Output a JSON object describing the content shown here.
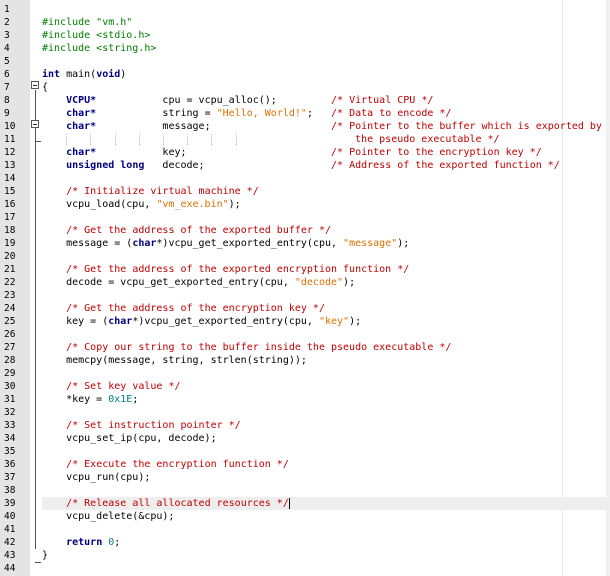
{
  "editor": {
    "colors": {
      "keyword": "#000080",
      "string": "#e07000",
      "comment": "#c00000",
      "preprocessor": "#008000",
      "number": "#008080"
    },
    "current_line": 39,
    "lines": [
      {
        "n": "1",
        "t": []
      },
      {
        "n": "2",
        "t": [
          {
            "c": "pp",
            "s": "#include \"vm.h\""
          }
        ]
      },
      {
        "n": "3",
        "t": [
          {
            "c": "pp",
            "s": "#include <stdio.h>"
          }
        ]
      },
      {
        "n": "4",
        "t": [
          {
            "c": "pp",
            "s": "#include <string.h>"
          }
        ]
      },
      {
        "n": "5",
        "t": []
      },
      {
        "n": "6",
        "t": [
          {
            "c": "kw",
            "s": "int"
          },
          {
            "c": "",
            "s": " main("
          },
          {
            "c": "kw",
            "s": "void"
          },
          {
            "c": "",
            "s": ")"
          }
        ]
      },
      {
        "n": "7",
        "t": [
          {
            "c": "",
            "s": "{"
          }
        ]
      },
      {
        "n": "8",
        "t": [
          {
            "c": "",
            "s": "    "
          },
          {
            "c": "kw",
            "s": "VCPU*"
          },
          {
            "c": "",
            "s": "           cpu = vcpu_alloc();         "
          },
          {
            "c": "cm",
            "s": "/* Virtual CPU */"
          }
        ]
      },
      {
        "n": "9",
        "t": [
          {
            "c": "",
            "s": "    "
          },
          {
            "c": "kw",
            "s": "char*"
          },
          {
            "c": "",
            "s": "           string = "
          },
          {
            "c": "str",
            "s": "\"Hello, World!\""
          },
          {
            "c": "",
            "s": ";   "
          },
          {
            "c": "cm",
            "s": "/* Data to encode */"
          }
        ]
      },
      {
        "n": "10",
        "t": [
          {
            "c": "",
            "s": "    "
          },
          {
            "c": "kw",
            "s": "char*"
          },
          {
            "c": "",
            "s": "           message;                    "
          },
          {
            "c": "cm",
            "s": "/* Pointer to the buffer which is exported by"
          }
        ]
      },
      {
        "n": "11",
        "t": [
          {
            "c": "",
            "s": "                                                 "
          },
          {
            "c": "cm",
            "s": "   the pseudo executable */"
          }
        ]
      },
      {
        "n": "12",
        "t": [
          {
            "c": "",
            "s": "    "
          },
          {
            "c": "kw",
            "s": "char*"
          },
          {
            "c": "",
            "s": "           key;                        "
          },
          {
            "c": "cm",
            "s": "/* Pointer to the encryption key */"
          }
        ]
      },
      {
        "n": "13",
        "t": [
          {
            "c": "",
            "s": "    "
          },
          {
            "c": "kw",
            "s": "unsigned long"
          },
          {
            "c": "",
            "s": "   decode;                     "
          },
          {
            "c": "cm",
            "s": "/* Address of the exported function */"
          }
        ]
      },
      {
        "n": "14",
        "t": []
      },
      {
        "n": "15",
        "t": [
          {
            "c": "",
            "s": "    "
          },
          {
            "c": "cm",
            "s": "/* Initialize virtual machine */"
          }
        ]
      },
      {
        "n": "16",
        "t": [
          {
            "c": "",
            "s": "    vcpu_load(cpu, "
          },
          {
            "c": "str",
            "s": "\"vm_exe.bin\""
          },
          {
            "c": "",
            "s": ");"
          }
        ]
      },
      {
        "n": "17",
        "t": []
      },
      {
        "n": "18",
        "t": [
          {
            "c": "",
            "s": "    "
          },
          {
            "c": "cm",
            "s": "/* Get the address of the exported buffer */"
          }
        ]
      },
      {
        "n": "19",
        "t": [
          {
            "c": "",
            "s": "    message = ("
          },
          {
            "c": "kw",
            "s": "char"
          },
          {
            "c": "",
            "s": "*)vcpu_get_exported_entry(cpu, "
          },
          {
            "c": "str",
            "s": "\"message\""
          },
          {
            "c": "",
            "s": ");"
          }
        ]
      },
      {
        "n": "20",
        "t": []
      },
      {
        "n": "21",
        "t": [
          {
            "c": "",
            "s": "    "
          },
          {
            "c": "cm",
            "s": "/* Get the address of the exported encryption function */"
          }
        ]
      },
      {
        "n": "22",
        "t": [
          {
            "c": "",
            "s": "    decode = vcpu_get_exported_entry(cpu, "
          },
          {
            "c": "str",
            "s": "\"decode\""
          },
          {
            "c": "",
            "s": ");"
          }
        ]
      },
      {
        "n": "23",
        "t": []
      },
      {
        "n": "24",
        "t": [
          {
            "c": "",
            "s": "    "
          },
          {
            "c": "cm",
            "s": "/* Get the address of the encryption key */"
          }
        ]
      },
      {
        "n": "25",
        "t": [
          {
            "c": "",
            "s": "    key = ("
          },
          {
            "c": "kw",
            "s": "char"
          },
          {
            "c": "",
            "s": "*)vcpu_get_exported_entry(cpu, "
          },
          {
            "c": "str",
            "s": "\"key\""
          },
          {
            "c": "",
            "s": ");"
          }
        ]
      },
      {
        "n": "26",
        "t": []
      },
      {
        "n": "27",
        "t": [
          {
            "c": "",
            "s": "    "
          },
          {
            "c": "cm",
            "s": "/* Copy our string to the buffer inside the pseudo executable */"
          }
        ]
      },
      {
        "n": "28",
        "t": [
          {
            "c": "",
            "s": "    memcpy(message, string, strlen(string));"
          }
        ]
      },
      {
        "n": "29",
        "t": []
      },
      {
        "n": "30",
        "t": [
          {
            "c": "",
            "s": "    "
          },
          {
            "c": "cm",
            "s": "/* Set key value */"
          }
        ]
      },
      {
        "n": "31",
        "t": [
          {
            "c": "",
            "s": "    *key = "
          },
          {
            "c": "num",
            "s": "0x1E"
          },
          {
            "c": "",
            "s": ";"
          }
        ]
      },
      {
        "n": "32",
        "t": []
      },
      {
        "n": "33",
        "t": [
          {
            "c": "",
            "s": "    "
          },
          {
            "c": "cm",
            "s": "/* Set instruction pointer */"
          }
        ]
      },
      {
        "n": "34",
        "t": [
          {
            "c": "",
            "s": "    vcpu_set_ip(cpu, decode);"
          }
        ]
      },
      {
        "n": "35",
        "t": []
      },
      {
        "n": "36",
        "t": [
          {
            "c": "",
            "s": "    "
          },
          {
            "c": "cm",
            "s": "/* Execute the encryption function */"
          }
        ]
      },
      {
        "n": "37",
        "t": [
          {
            "c": "",
            "s": "    vcpu_run(cpu);"
          }
        ]
      },
      {
        "n": "38",
        "t": []
      },
      {
        "n": "39",
        "t": [
          {
            "c": "",
            "s": "    "
          },
          {
            "c": "cm",
            "s": "/* Release all allocated resources */"
          }
        ]
      },
      {
        "n": "40",
        "t": [
          {
            "c": "",
            "s": "    vcpu_delete(&cpu);"
          }
        ]
      },
      {
        "n": "41",
        "t": []
      },
      {
        "n": "42",
        "t": [
          {
            "c": "",
            "s": "    "
          },
          {
            "c": "kw",
            "s": "return"
          },
          {
            "c": "",
            "s": " "
          },
          {
            "c": "num",
            "s": "0"
          },
          {
            "c": "",
            "s": ";"
          }
        ]
      },
      {
        "n": "43",
        "t": [
          {
            "c": "",
            "s": "}"
          }
        ]
      },
      {
        "n": "44",
        "t": []
      }
    ]
  }
}
